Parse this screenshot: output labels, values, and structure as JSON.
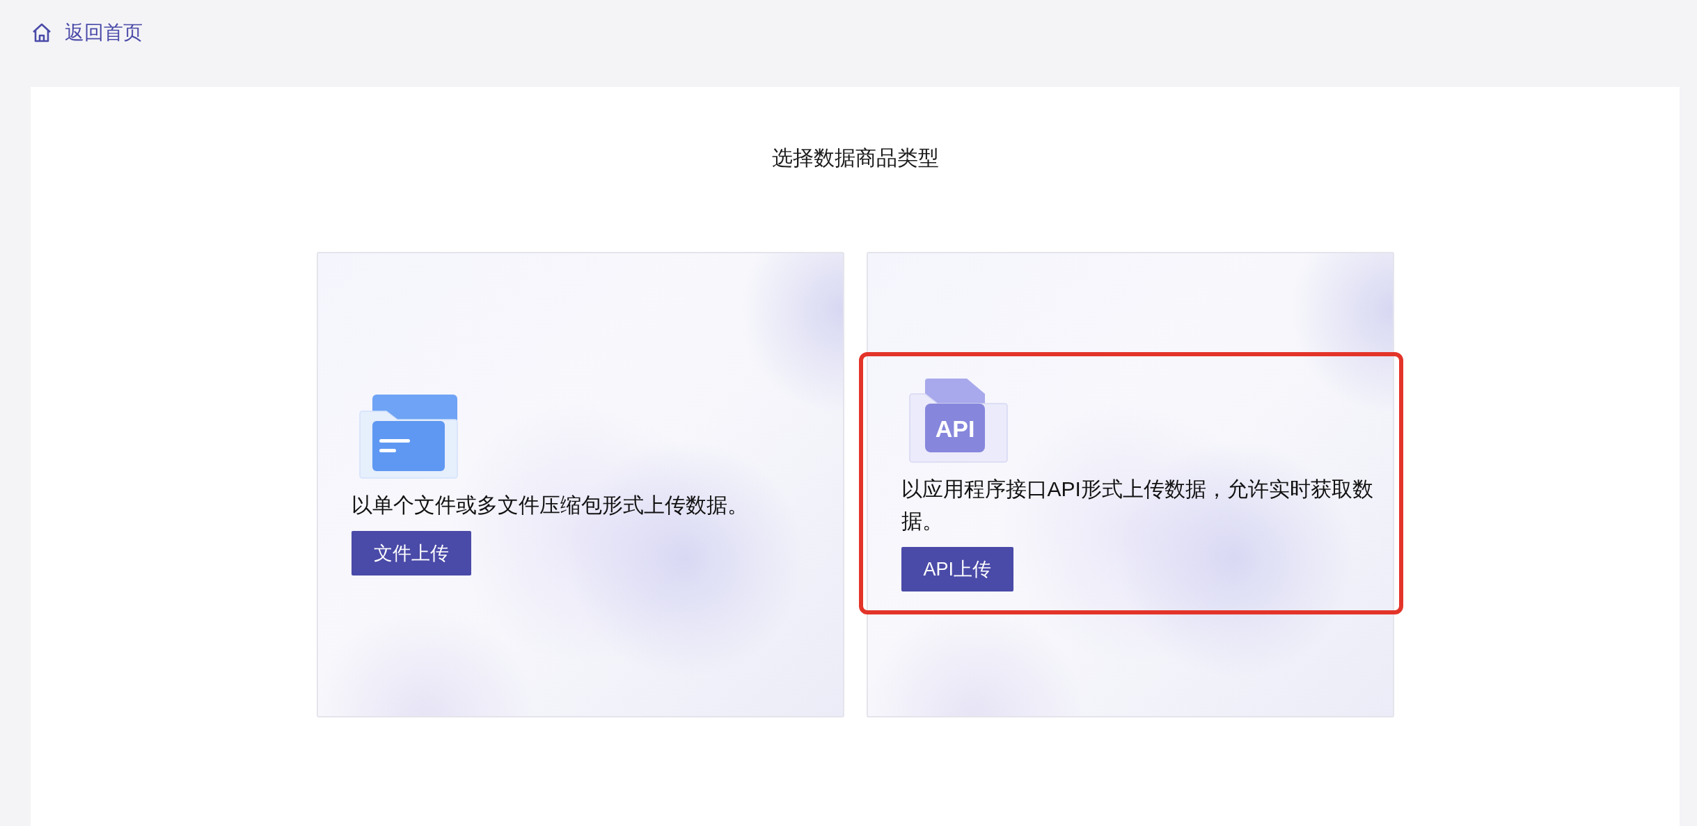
{
  "back_link": {
    "label": "返回首页"
  },
  "title": "选择数据商品类型",
  "cards": [
    {
      "kind": "file",
      "description": "以单个文件或多文件压缩包形式上传数据。",
      "button": "文件上传",
      "highlighted": false
    },
    {
      "kind": "api",
      "icon_label": "API",
      "description": "以应用程序接口API形式上传数据，允许实时获取数据。",
      "button": "API上传",
      "highlighted": true
    }
  ]
}
